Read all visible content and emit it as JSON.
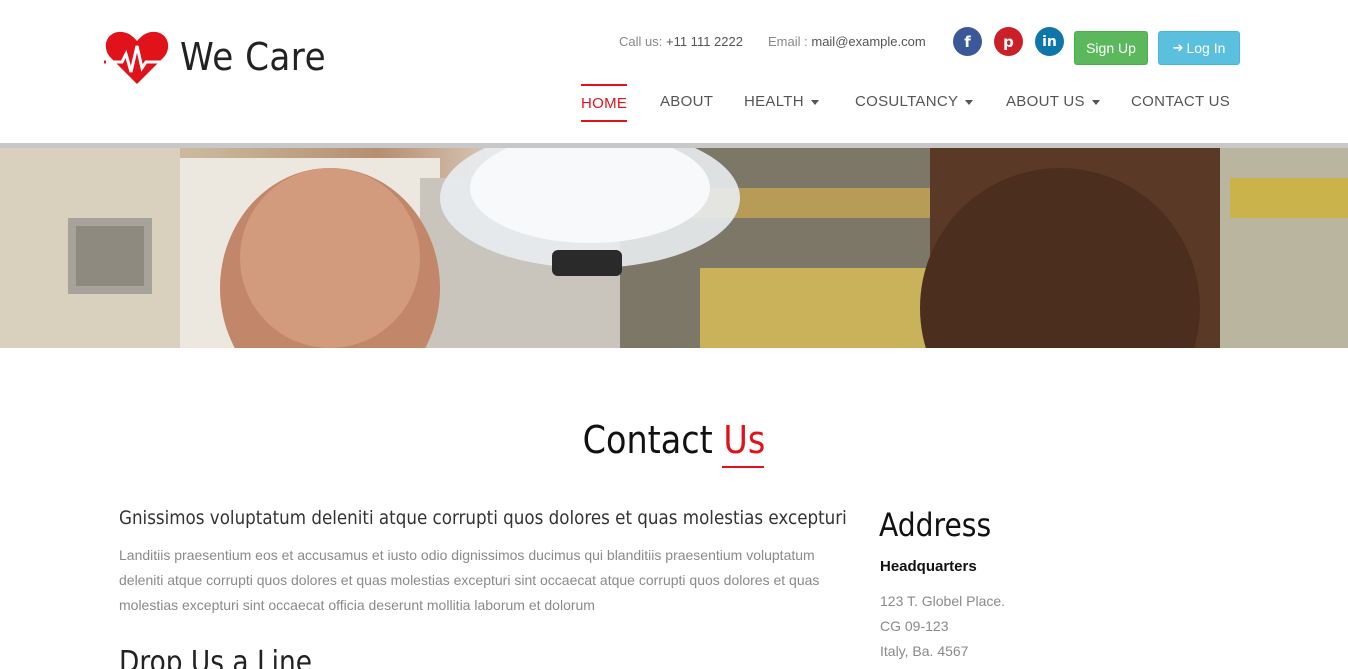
{
  "brand": {
    "name": "We Care",
    "accent_color": "#e0131b"
  },
  "topbar": {
    "call_label": "Call us:",
    "call_value": "+11 111 2222",
    "email_label": "Email :",
    "email_value": "mail@example.com"
  },
  "social": {
    "facebook": "f",
    "pinterest": "p",
    "linkedin": "in"
  },
  "buttons": {
    "signup": "Sign Up",
    "login": "Log In",
    "signup_color": "#5cb85c",
    "login_color": "#5bc0de"
  },
  "nav": {
    "items": [
      {
        "label": "HOME"
      },
      {
        "label": "ABOUT"
      },
      {
        "label": "HEALTH"
      },
      {
        "label": "COSULTANCY"
      },
      {
        "label": "ABOUT US"
      },
      {
        "label": "CONTACT US"
      }
    ]
  },
  "main": {
    "title_part1": "Contact ",
    "title_part2": "Us",
    "lead": "Gnissimos voluptatum deleniti atque corrupti quos dolores et quas molestias excepturi",
    "paragraph": "Landitiis praesentium eos et accusamus et iusto odio dignissimos ducimus qui blanditiis praesentium voluptatum deleniti atque corrupti quos dolores et quas molestias excepturi sint occaecat atque corrupti quos dolores et quas molestias excepturi sint occaecat officia deserunt mollitia laborum et dolorum",
    "drop_heading": "Drop Us a Line"
  },
  "address": {
    "title": "Address",
    "subtitle": "Headquarters",
    "lines": [
      "123 T. Globel Place.",
      "CG 09-123",
      "Italy, Ba. 4567"
    ]
  }
}
